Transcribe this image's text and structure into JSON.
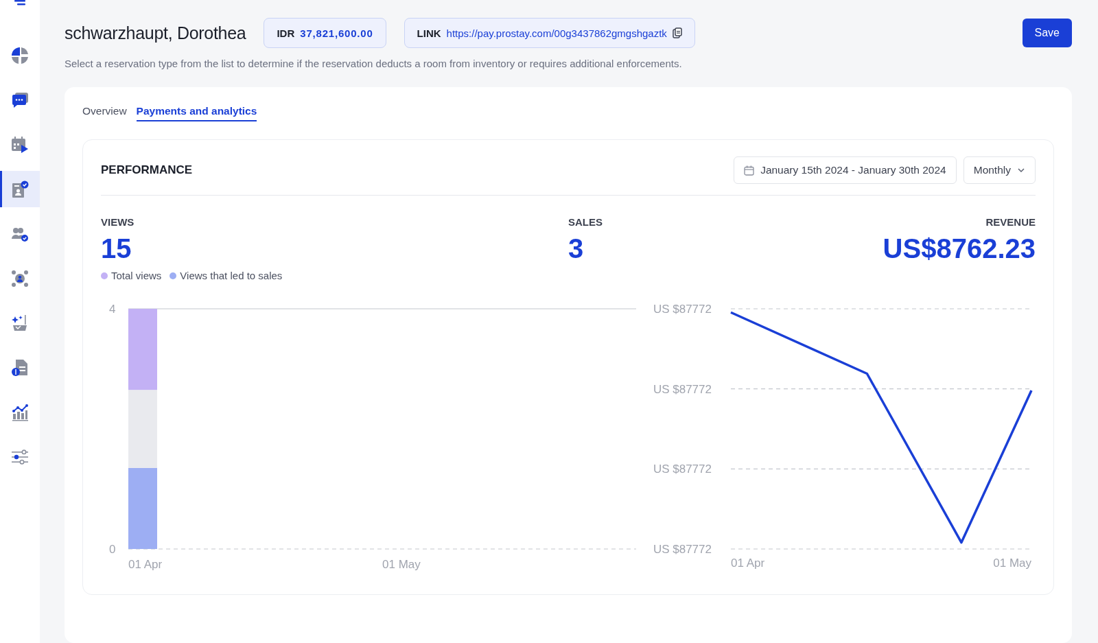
{
  "sidebar": {
    "items": [
      {
        "kind": "pie",
        "selected": false
      },
      {
        "kind": "chat",
        "selected": false
      },
      {
        "kind": "calendar",
        "selected": false
      },
      {
        "kind": "badge",
        "selected": true
      },
      {
        "kind": "users",
        "selected": false
      },
      {
        "kind": "network",
        "selected": false
      },
      {
        "kind": "sparkle",
        "selected": false
      },
      {
        "kind": "invoice",
        "selected": false
      },
      {
        "kind": "analytics",
        "selected": false
      },
      {
        "kind": "sliders",
        "selected": false
      }
    ]
  },
  "header": {
    "title": "schwarzhaupt, Dorothea",
    "amount": {
      "label": "IDR",
      "value": "37,821,600.00"
    },
    "link": {
      "label": "LINK",
      "url": "https://pay.prostay.com/00g3437862gmgshgaztk"
    },
    "save": "Save",
    "description": "Select a reservation type from the list to determine if the reservation deducts a room from inventory or requires additional enforcements."
  },
  "tabs": [
    {
      "label": "Overview",
      "selected": false
    },
    {
      "label": "Payments and analytics",
      "selected": true
    }
  ],
  "performance": {
    "title": "PERFORMANCE",
    "date_range": "January 15th 2024 - January 30th 2024",
    "period": "Monthly",
    "stats": [
      {
        "label": "VIEWS",
        "value": "15"
      },
      {
        "label": "SALES",
        "value": "3"
      },
      {
        "label": "REVENUE",
        "value": "US$8762.23"
      }
    ],
    "views_chart": {
      "chart_data": {
        "type": "bar",
        "stacked": true,
        "categories": [
          "01 Apr",
          "01 May"
        ],
        "ylim": [
          0,
          4
        ],
        "yticks": [
          0,
          4
        ],
        "series": [
          {
            "name": "Views that led to sales",
            "color": "#9daef3",
            "values": [
              1.35,
              null
            ]
          },
          {
            "color": "#e9eaee",
            "values": [
              1.3,
              null
            ]
          },
          {
            "name": "Total views",
            "color": "#c3b1f5",
            "values": [
              1.35,
              null
            ]
          }
        ]
      }
    },
    "revenue_chart": {
      "y_labels": [
        "US $87772",
        "US $87772",
        "US $87772",
        "US $87772"
      ],
      "x_labels": [
        "01 Apr",
        "01 May"
      ]
    }
  }
}
